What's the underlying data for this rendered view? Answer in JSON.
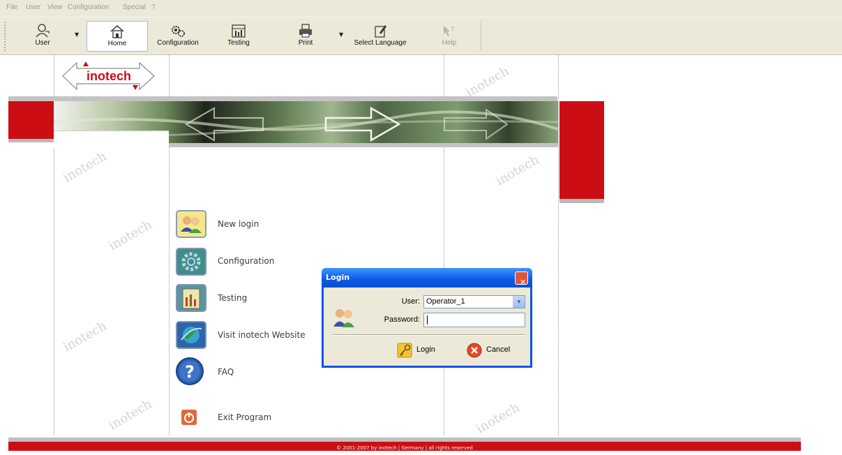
{
  "menu": [
    "File",
    "User",
    "View",
    "Configuration",
    "Special",
    "?"
  ],
  "toolbar": {
    "user": {
      "label": "User",
      "icon": "user-icon"
    },
    "home": {
      "label": "Home",
      "icon": "home-icon"
    },
    "configuration": {
      "label": "Configuration",
      "icon": "gears-icon"
    },
    "testing": {
      "label": "Testing",
      "icon": "testing-icon"
    },
    "print": {
      "label": "Print",
      "icon": "printer-icon"
    },
    "language": {
      "label": "Select Language",
      "icon": "language-icon"
    },
    "help": {
      "label": "Help",
      "icon": "help-icon"
    }
  },
  "brand": {
    "logo_text": "inotech",
    "watermark": "inotech"
  },
  "nav": {
    "new_login": "New login",
    "configuration": "Configuration",
    "testing": "Testing",
    "website": "Visit inotech Website",
    "faq": "FAQ",
    "exit": "Exit Program"
  },
  "footer": {
    "text": "© 2001-2007 by inotech | Germany | all rights reserved"
  },
  "dialog": {
    "title": "Login",
    "close": "✕",
    "user_label": "User:",
    "user_value": "Operator_1",
    "password_label": "Password:",
    "password_value": "",
    "login_label": "Login",
    "cancel_label": "Cancel"
  },
  "colors": {
    "brand_red": "#cc0e14",
    "banner_green": "#7a9a6e",
    "xp_blue": "#0a54e8",
    "window_bg": "#ece9d8"
  }
}
